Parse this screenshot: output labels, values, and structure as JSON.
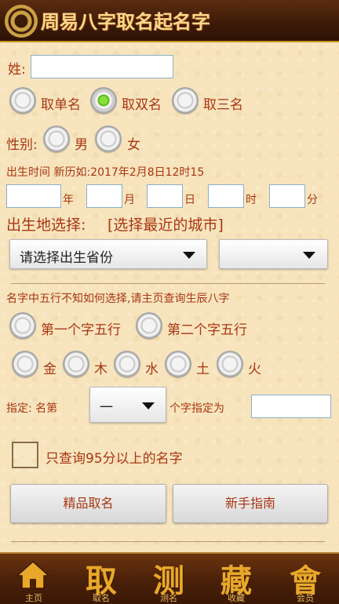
{
  "header": {
    "title": "周易八字取名起名字",
    "logo_icon": "yinyang-logo-icon"
  },
  "surname": {
    "label": "姓:",
    "value": ""
  },
  "name_length": {
    "options": [
      "取单名",
      "取双名",
      "取三名"
    ],
    "selected": "取双名"
  },
  "gender": {
    "label": "性别:",
    "options": [
      "男",
      "女"
    ]
  },
  "birth": {
    "label": "出生时间 新历如:2017年2月8日12时15",
    "units": [
      "年",
      "月",
      "日",
      "时",
      "分"
    ],
    "values": [
      "",
      "",
      "",
      "",
      ""
    ]
  },
  "birthplace": {
    "label": "出生地选择:",
    "nearest_city": "[选择最近的城市]",
    "province_placeholder": "请选择出生省份",
    "city_value": ""
  },
  "wuxing": {
    "hint": "名字中五行不知如何选择,请主页查询生辰八字",
    "positions": [
      "第一个字五行",
      "第二个字五行"
    ],
    "elements": [
      "金",
      "木",
      "水",
      "土",
      "火"
    ]
  },
  "assign": {
    "prefix": "指定: 名第",
    "ordinal": "一",
    "suffix": "个字指定为",
    "value": ""
  },
  "filter": {
    "label": "只查询95分以上的名字"
  },
  "buttons": {
    "premium": "精品取名",
    "guide": "新手指南"
  },
  "nav": [
    {
      "glyph": "",
      "label": "主页",
      "icon": "home-icon"
    },
    {
      "glyph": "取",
      "label": "取名"
    },
    {
      "glyph": "测",
      "label": "测名"
    },
    {
      "glyph": "藏",
      "label": "收藏"
    },
    {
      "glyph": "會",
      "label": "会员"
    }
  ],
  "colors": {
    "accent": "#a83712",
    "header_bg": "#3c1a08",
    "radio_on": "#8ae03a"
  }
}
